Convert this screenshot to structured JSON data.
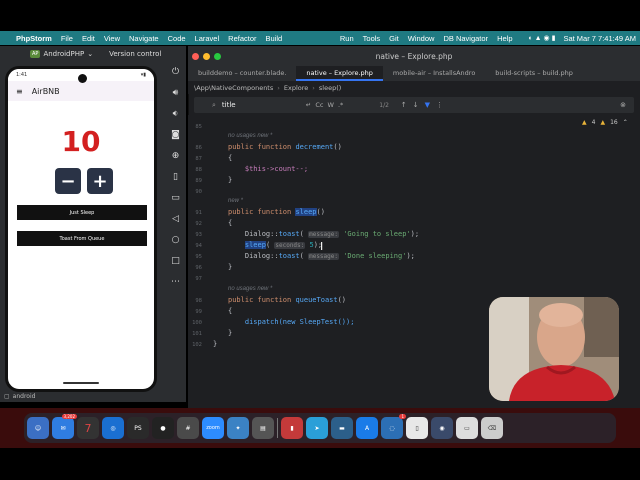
{
  "menubar": {
    "app": "PhpStorm",
    "items": [
      "File",
      "Edit",
      "View",
      "Navigate",
      "Code",
      "Laravel",
      "Refactor",
      "Build",
      "Run",
      "Tools",
      "Git",
      "Window",
      "DB Navigator",
      "Help"
    ],
    "clock": "Sat Mar 7  7:41:49 AM"
  },
  "emulator": {
    "device": "AndroidPHP",
    "version_control": "Version control",
    "bottom_label": "android",
    "phone": {
      "time": "1:41",
      "app_title": "AirBNB",
      "counter": "10",
      "minus": "−",
      "plus": "+",
      "btn_sleep": "Just Sleep",
      "btn_queue": "Toast From Queue"
    }
  },
  "ide": {
    "window_title": "native – Explore.php",
    "tabs": [
      "builddemo – counter.blade.",
      "native – Explore.php",
      "mobile-air – InstallsAndro",
      "build-scripts – build.php"
    ],
    "active_tab": 1,
    "breadcrumb": [
      "\\App\\NativeComponents",
      "Explore",
      "sleep()"
    ],
    "find": {
      "query": "title",
      "count": "1/2",
      "opts": [
        "Cc",
        "W",
        ".*"
      ]
    },
    "warnings": {
      "warn": "4",
      "weak": "16"
    },
    "hints": {
      "no_usages": "no usages  new *",
      "new": "new *"
    },
    "lines": [
      "85",
      "86",
      "87",
      "88",
      "89",
      "90",
      "91",
      "92",
      "93",
      "94",
      "95",
      "96",
      "97",
      "98",
      "99",
      "100",
      "101",
      "102"
    ],
    "code": {
      "fn_decrement": "decrement",
      "decrement_body": "$this->count--;",
      "fn_sleep": "sleep",
      "toast_going": "'Going to sleep'",
      "sleep_call": "sleep",
      "sleep_arg": "5",
      "toast_done": "'Done sleeping'",
      "fn_queue": "queueToast",
      "dispatch": "dispatch(new SleepTest());",
      "ph_message": "message:",
      "ph_seconds": "seconds:"
    }
  },
  "dock": {
    "badge_mail": "3,202",
    "badge_msg": "1"
  }
}
